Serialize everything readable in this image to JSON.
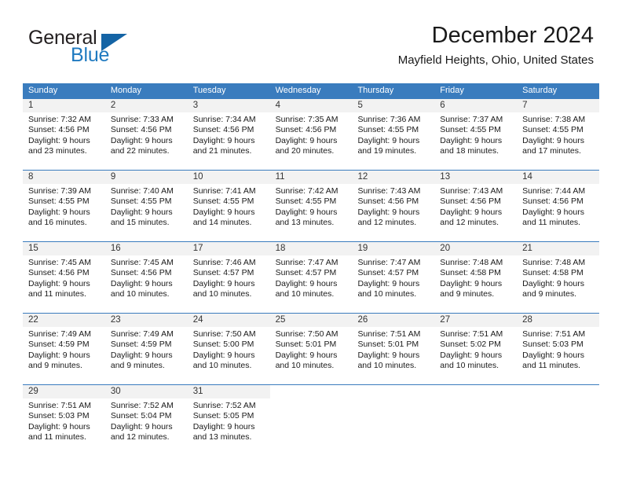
{
  "brand": {
    "name_top": "General",
    "name_bottom": "Blue",
    "top_color": "#231f20",
    "bottom_color": "#1f7ac0",
    "triangle_color": "#1464a5",
    "triangle_icon": "triangle-icon"
  },
  "header": {
    "month_title": "December 2024",
    "location": "Mayfield Heights, Ohio, United States"
  },
  "theme": {
    "header_blue": "#3a7cbe",
    "daynum_band": "#f2f2f2",
    "text": "#1a1a1a"
  },
  "weekdays": [
    "Sunday",
    "Monday",
    "Tuesday",
    "Wednesday",
    "Thursday",
    "Friday",
    "Saturday"
  ],
  "weeks": [
    [
      {
        "day": "1",
        "sunrise": "Sunrise: 7:32 AM",
        "sunset": "Sunset: 4:56 PM",
        "daylight1": "Daylight: 9 hours",
        "daylight2": "and 23 minutes."
      },
      {
        "day": "2",
        "sunrise": "Sunrise: 7:33 AM",
        "sunset": "Sunset: 4:56 PM",
        "daylight1": "Daylight: 9 hours",
        "daylight2": "and 22 minutes."
      },
      {
        "day": "3",
        "sunrise": "Sunrise: 7:34 AM",
        "sunset": "Sunset: 4:56 PM",
        "daylight1": "Daylight: 9 hours",
        "daylight2": "and 21 minutes."
      },
      {
        "day": "4",
        "sunrise": "Sunrise: 7:35 AM",
        "sunset": "Sunset: 4:56 PM",
        "daylight1": "Daylight: 9 hours",
        "daylight2": "and 20 minutes."
      },
      {
        "day": "5",
        "sunrise": "Sunrise: 7:36 AM",
        "sunset": "Sunset: 4:55 PM",
        "daylight1": "Daylight: 9 hours",
        "daylight2": "and 19 minutes."
      },
      {
        "day": "6",
        "sunrise": "Sunrise: 7:37 AM",
        "sunset": "Sunset: 4:55 PM",
        "daylight1": "Daylight: 9 hours",
        "daylight2": "and 18 minutes."
      },
      {
        "day": "7",
        "sunrise": "Sunrise: 7:38 AM",
        "sunset": "Sunset: 4:55 PM",
        "daylight1": "Daylight: 9 hours",
        "daylight2": "and 17 minutes."
      }
    ],
    [
      {
        "day": "8",
        "sunrise": "Sunrise: 7:39 AM",
        "sunset": "Sunset: 4:55 PM",
        "daylight1": "Daylight: 9 hours",
        "daylight2": "and 16 minutes."
      },
      {
        "day": "9",
        "sunrise": "Sunrise: 7:40 AM",
        "sunset": "Sunset: 4:55 PM",
        "daylight1": "Daylight: 9 hours",
        "daylight2": "and 15 minutes."
      },
      {
        "day": "10",
        "sunrise": "Sunrise: 7:41 AM",
        "sunset": "Sunset: 4:55 PM",
        "daylight1": "Daylight: 9 hours",
        "daylight2": "and 14 minutes."
      },
      {
        "day": "11",
        "sunrise": "Sunrise: 7:42 AM",
        "sunset": "Sunset: 4:55 PM",
        "daylight1": "Daylight: 9 hours",
        "daylight2": "and 13 minutes."
      },
      {
        "day": "12",
        "sunrise": "Sunrise: 7:43 AM",
        "sunset": "Sunset: 4:56 PM",
        "daylight1": "Daylight: 9 hours",
        "daylight2": "and 12 minutes."
      },
      {
        "day": "13",
        "sunrise": "Sunrise: 7:43 AM",
        "sunset": "Sunset: 4:56 PM",
        "daylight1": "Daylight: 9 hours",
        "daylight2": "and 12 minutes."
      },
      {
        "day": "14",
        "sunrise": "Sunrise: 7:44 AM",
        "sunset": "Sunset: 4:56 PM",
        "daylight1": "Daylight: 9 hours",
        "daylight2": "and 11 minutes."
      }
    ],
    [
      {
        "day": "15",
        "sunrise": "Sunrise: 7:45 AM",
        "sunset": "Sunset: 4:56 PM",
        "daylight1": "Daylight: 9 hours",
        "daylight2": "and 11 minutes."
      },
      {
        "day": "16",
        "sunrise": "Sunrise: 7:45 AM",
        "sunset": "Sunset: 4:56 PM",
        "daylight1": "Daylight: 9 hours",
        "daylight2": "and 10 minutes."
      },
      {
        "day": "17",
        "sunrise": "Sunrise: 7:46 AM",
        "sunset": "Sunset: 4:57 PM",
        "daylight1": "Daylight: 9 hours",
        "daylight2": "and 10 minutes."
      },
      {
        "day": "18",
        "sunrise": "Sunrise: 7:47 AM",
        "sunset": "Sunset: 4:57 PM",
        "daylight1": "Daylight: 9 hours",
        "daylight2": "and 10 minutes."
      },
      {
        "day": "19",
        "sunrise": "Sunrise: 7:47 AM",
        "sunset": "Sunset: 4:57 PM",
        "daylight1": "Daylight: 9 hours",
        "daylight2": "and 10 minutes."
      },
      {
        "day": "20",
        "sunrise": "Sunrise: 7:48 AM",
        "sunset": "Sunset: 4:58 PM",
        "daylight1": "Daylight: 9 hours",
        "daylight2": "and 9 minutes."
      },
      {
        "day": "21",
        "sunrise": "Sunrise: 7:48 AM",
        "sunset": "Sunset: 4:58 PM",
        "daylight1": "Daylight: 9 hours",
        "daylight2": "and 9 minutes."
      }
    ],
    [
      {
        "day": "22",
        "sunrise": "Sunrise: 7:49 AM",
        "sunset": "Sunset: 4:59 PM",
        "daylight1": "Daylight: 9 hours",
        "daylight2": "and 9 minutes."
      },
      {
        "day": "23",
        "sunrise": "Sunrise: 7:49 AM",
        "sunset": "Sunset: 4:59 PM",
        "daylight1": "Daylight: 9 hours",
        "daylight2": "and 9 minutes."
      },
      {
        "day": "24",
        "sunrise": "Sunrise: 7:50 AM",
        "sunset": "Sunset: 5:00 PM",
        "daylight1": "Daylight: 9 hours",
        "daylight2": "and 10 minutes."
      },
      {
        "day": "25",
        "sunrise": "Sunrise: 7:50 AM",
        "sunset": "Sunset: 5:01 PM",
        "daylight1": "Daylight: 9 hours",
        "daylight2": "and 10 minutes."
      },
      {
        "day": "26",
        "sunrise": "Sunrise: 7:51 AM",
        "sunset": "Sunset: 5:01 PM",
        "daylight1": "Daylight: 9 hours",
        "daylight2": "and 10 minutes."
      },
      {
        "day": "27",
        "sunrise": "Sunrise: 7:51 AM",
        "sunset": "Sunset: 5:02 PM",
        "daylight1": "Daylight: 9 hours",
        "daylight2": "and 10 minutes."
      },
      {
        "day": "28",
        "sunrise": "Sunrise: 7:51 AM",
        "sunset": "Sunset: 5:03 PM",
        "daylight1": "Daylight: 9 hours",
        "daylight2": "and 11 minutes."
      }
    ],
    [
      {
        "day": "29",
        "sunrise": "Sunrise: 7:51 AM",
        "sunset": "Sunset: 5:03 PM",
        "daylight1": "Daylight: 9 hours",
        "daylight2": "and 11 minutes."
      },
      {
        "day": "30",
        "sunrise": "Sunrise: 7:52 AM",
        "sunset": "Sunset: 5:04 PM",
        "daylight1": "Daylight: 9 hours",
        "daylight2": "and 12 minutes."
      },
      {
        "day": "31",
        "sunrise": "Sunrise: 7:52 AM",
        "sunset": "Sunset: 5:05 PM",
        "daylight1": "Daylight: 9 hours",
        "daylight2": "and 13 minutes."
      },
      {
        "day": "",
        "sunrise": "",
        "sunset": "",
        "daylight1": "",
        "daylight2": ""
      },
      {
        "day": "",
        "sunrise": "",
        "sunset": "",
        "daylight1": "",
        "daylight2": ""
      },
      {
        "day": "",
        "sunrise": "",
        "sunset": "",
        "daylight1": "",
        "daylight2": ""
      },
      {
        "day": "",
        "sunrise": "",
        "sunset": "",
        "daylight1": "",
        "daylight2": ""
      }
    ]
  ]
}
